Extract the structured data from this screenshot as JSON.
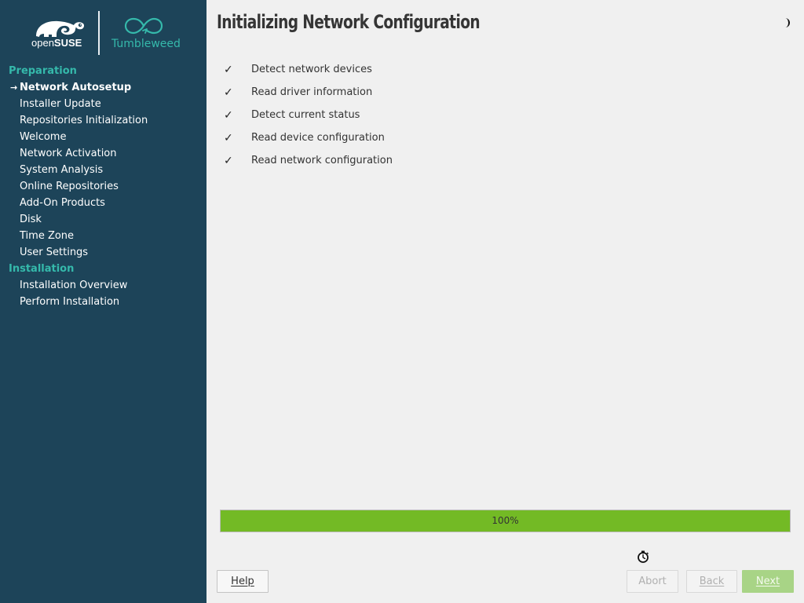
{
  "logo": {
    "opensuse_prefix": "open",
    "opensuse_suffix": "SUSE",
    "tumbleweed": "Tumbleweed"
  },
  "sidebar": {
    "groups": [
      {
        "label": "Preparation",
        "steps": [
          {
            "label": "Network Autosetup",
            "current": true
          },
          {
            "label": "Installer Update"
          },
          {
            "label": "Repositories Initialization"
          },
          {
            "label": "Welcome"
          },
          {
            "label": "Network Activation"
          },
          {
            "label": "System Analysis"
          },
          {
            "label": "Online Repositories"
          },
          {
            "label": "Add-On Products"
          },
          {
            "label": "Disk"
          },
          {
            "label": "Time Zone"
          },
          {
            "label": "User Settings"
          }
        ]
      },
      {
        "label": "Installation",
        "steps": [
          {
            "label": "Installation Overview"
          },
          {
            "label": "Perform Installation"
          }
        ]
      }
    ],
    "current_marker": "→"
  },
  "main": {
    "title": "Initializing Network Configuration",
    "tasks": [
      {
        "check": "✓",
        "label": "Detect network devices"
      },
      {
        "check": "✓",
        "label": "Read driver information"
      },
      {
        "check": "✓",
        "label": "Detect current status"
      },
      {
        "check": "✓",
        "label": "Read device configuration"
      },
      {
        "check": "✓",
        "label": "Read network configuration"
      }
    ],
    "progress": {
      "value": 100,
      "label": "100%"
    }
  },
  "buttons": {
    "help": "Help",
    "abort": "Abort",
    "back": "Back",
    "next": "Next"
  },
  "colors": {
    "sidebar_bg": "#1d4459",
    "accent": "#35b9ab",
    "progress_fill": "#73ba25",
    "next_button": "#a8d486"
  },
  "icons": {
    "theme_toggle": "half-moon-icon",
    "busy": "stopwatch-icon",
    "logo": "chameleon-logo-icon",
    "tumbleweed": "infinity-logo-icon"
  }
}
